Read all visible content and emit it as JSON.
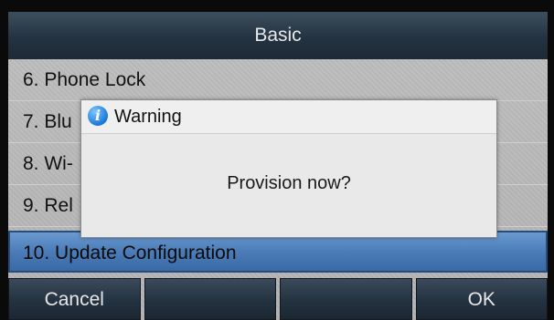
{
  "header": {
    "title": "Basic"
  },
  "menu": {
    "items": [
      {
        "label": "6. Phone Lock"
      },
      {
        "label": "7. Blu"
      },
      {
        "label": "8. Wi-"
      },
      {
        "label": "9. Rel"
      },
      {
        "label": "10. Update Configuration"
      }
    ],
    "selected_index": 4
  },
  "dialog": {
    "icon": "info-icon",
    "title": "Warning",
    "message": "Provision now?"
  },
  "softkeys": [
    {
      "label": "Cancel"
    },
    {
      "label": ""
    },
    {
      "label": ""
    },
    {
      "label": "OK"
    }
  ],
  "colors": {
    "selection": "#4b7cb8",
    "bar": "#243341"
  }
}
